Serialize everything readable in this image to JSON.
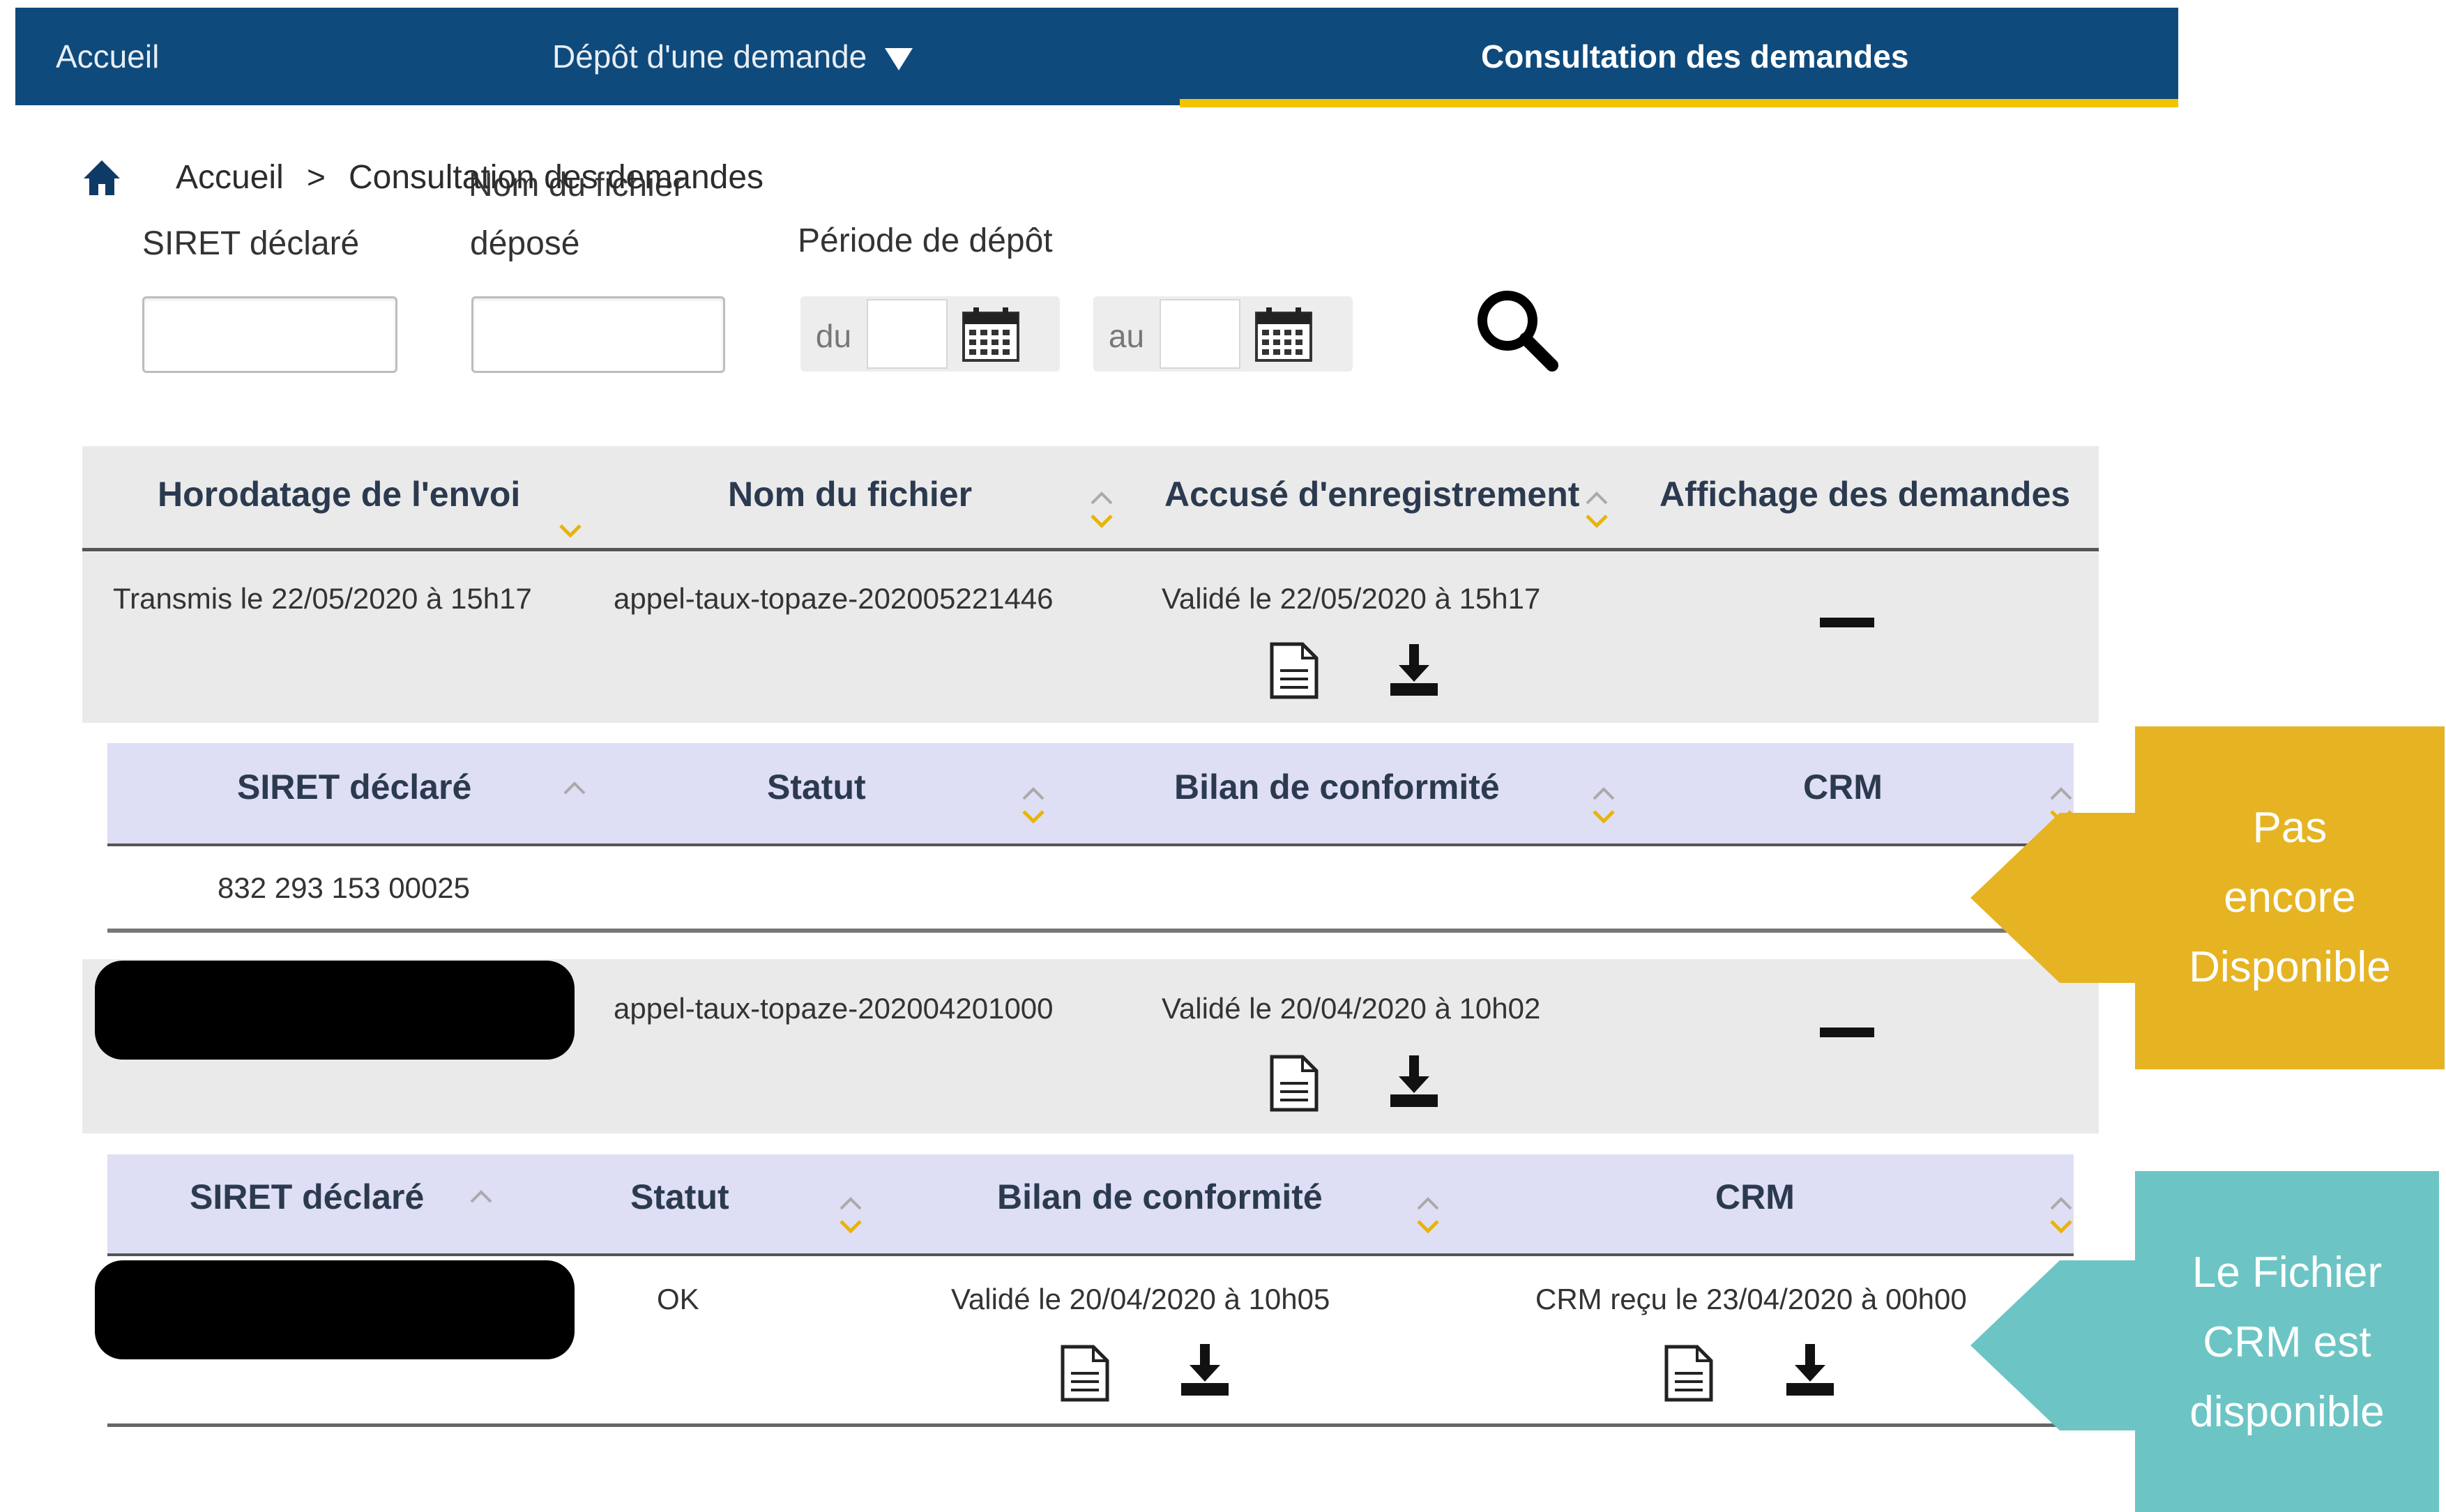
{
  "nav": {
    "home": "Accueil",
    "depot": "Dépôt d'une demande",
    "consultation": "Consultation des demandes"
  },
  "breadcrumb": {
    "home": "Accueil",
    "separator": ">",
    "current": "Consultation des demandes"
  },
  "search": {
    "siret_label": "SIRET déclaré",
    "filename_label_line1": "Nom du fichier",
    "filename_label_line2": "déposé",
    "period_label": "Période de dépôt",
    "from_label": "du",
    "to_label": "au"
  },
  "main_table": {
    "headers": [
      "Horodatage de l'envoi",
      "Nom du fichier",
      "Accusé d'enregistrement",
      "Affichage des demandes"
    ],
    "rows": [
      {
        "timestamp": "Transmis le 22/05/2020 à 15h17",
        "filename": "appel-taux-topaze-202005221446",
        "receipt": "Validé le 22/05/2020 à 15h17",
        "sub_table": {
          "headers": [
            "SIRET déclaré",
            "Statut",
            "Bilan de conformité",
            "CRM"
          ],
          "rows": [
            {
              "siret": "832 293 153 00025",
              "status": "",
              "compliance": "",
              "crm": ""
            }
          ]
        }
      },
      {
        "timestamp": "",
        "filename": "appel-taux-topaze-202004201000",
        "receipt": "Validé le 20/04/2020 à 10h02",
        "sub_table": {
          "headers": [
            "SIRET déclaré",
            "Statut",
            "Bilan de conformité",
            "CRM"
          ],
          "rows": [
            {
              "siret": "",
              "status": "OK",
              "compliance": "Validé le 20/04/2020 à 10h05",
              "crm": "CRM reçu le 23/04/2020 à 00h00"
            }
          ]
        }
      }
    ]
  },
  "callouts": {
    "not_available": {
      "lines": [
        "Pas",
        "encore",
        "Disponible"
      ],
      "color": "#e6b323"
    },
    "available": {
      "lines": [
        "Le Fichier",
        "CRM est",
        "disponible"
      ],
      "color": "#6cc5c4"
    }
  },
  "colors": {
    "nav_bg": "#0f4a7c",
    "nav_accent": "#f2c400",
    "sort_arrow": "#e8b40a",
    "sub_header_bg": "#dedef5",
    "row_band": "#eaeaea"
  }
}
